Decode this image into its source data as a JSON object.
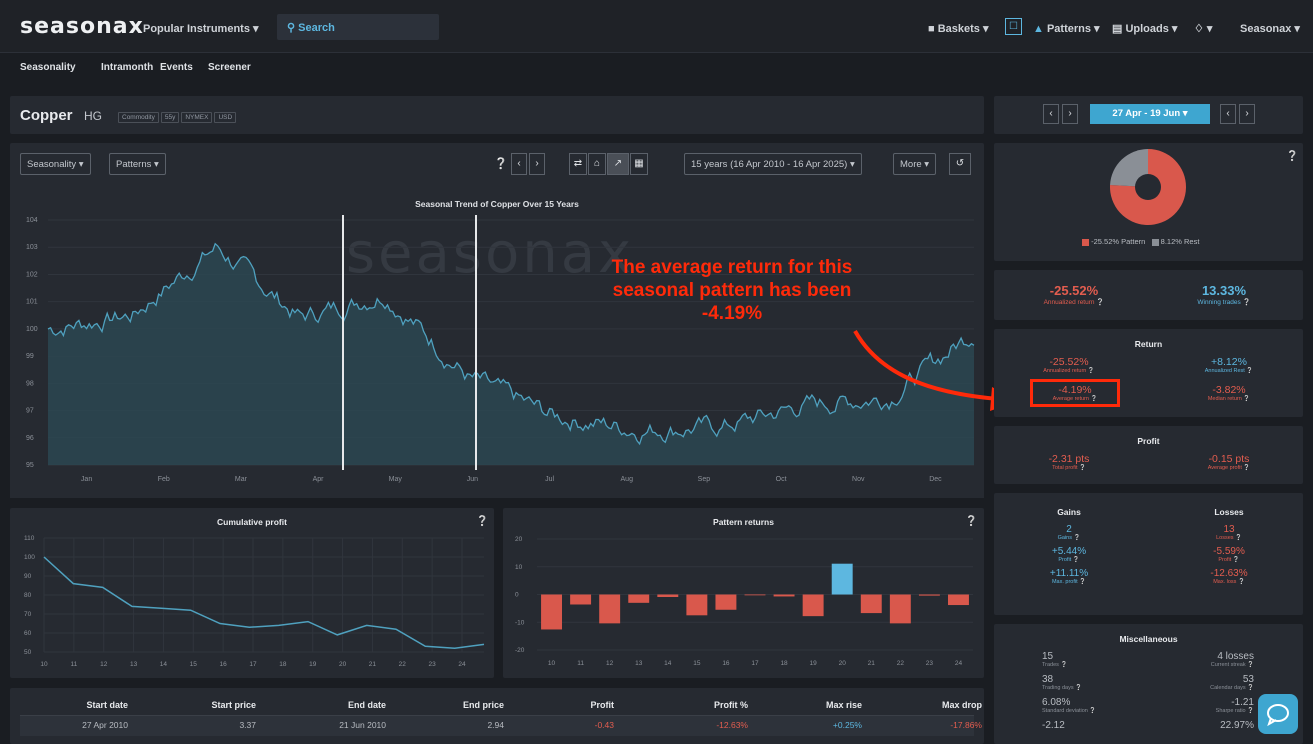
{
  "header": {
    "logo": "seasonax",
    "popular": "Popular Instruments ▾",
    "search": "Search",
    "baskets": "Baskets ▾",
    "patterns": "Patterns ▾",
    "uploads": "Uploads ▾",
    "bell": "▾",
    "account": "Seasonax ▾"
  },
  "subnav": [
    "Seasonality",
    "Intramonth",
    "Events",
    "Screener"
  ],
  "instrument": {
    "name": "Copper",
    "ticker": "HG",
    "tags": [
      "Commodity",
      "55y",
      "NYMEX",
      "USD"
    ]
  },
  "toolbar": {
    "seasonality": "Seasonality ▾",
    "patterns": "Patterns ▾",
    "range": "15 years (16 Apr 2010 - 16 Apr 2025) ▾",
    "more": "More ▾"
  },
  "date_range": "27 Apr - 19 Jun ▾",
  "main_chart": {
    "title": "Seasonal Trend of Copper Over 15 Years",
    "watermark": "seasonax",
    "y_ticks": [
      "104",
      "103",
      "102",
      "101",
      "100",
      "99",
      "98",
      "97",
      "96",
      "95"
    ],
    "x_ticks": [
      "Jan",
      "Feb",
      "Mar",
      "Apr",
      "May",
      "Jun",
      "Jul",
      "Aug",
      "Sep",
      "Oct",
      "Nov",
      "Dec"
    ]
  },
  "chart_data": [
    {
      "type": "area",
      "title": "Seasonal Trend of Copper Over 15 Years",
      "categories": [
        "Jan",
        "Feb",
        "Mar",
        "Apr",
        "May",
        "Jun",
        "Jul",
        "Aug",
        "Sep",
        "Oct",
        "Nov",
        "Dec"
      ],
      "ylim": [
        95,
        104
      ],
      "series": [
        {
          "values": [
            100.0,
            100.5,
            103.0,
            100.4,
            101.3,
            98.2,
            96.8,
            96.3,
            96.4,
            97.2,
            97.5,
            99.9
          ]
        }
      ],
      "highlight": [
        "27 Apr",
        "19 Jun"
      ]
    },
    {
      "type": "line",
      "title": "Cumulative profit",
      "categories": [
        "10",
        "11",
        "12",
        "13",
        "14",
        "15",
        "16",
        "17",
        "18",
        "19",
        "20",
        "21",
        "22",
        "23",
        "24"
      ],
      "ylim": [
        50,
        110
      ],
      "y_ticks": [
        "110",
        "100",
        "90",
        "80",
        "70",
        "60",
        "50"
      ],
      "series": [
        {
          "values": [
            100,
            86,
            84,
            74,
            73,
            72,
            65,
            63,
            64,
            66,
            59,
            64,
            62,
            53,
            52,
            54
          ]
        }
      ]
    },
    {
      "type": "bar",
      "title": "Pattern returns",
      "categories": [
        "10",
        "11",
        "12",
        "13",
        "14",
        "15",
        "16",
        "17",
        "18",
        "19",
        "20",
        "21",
        "22",
        "23",
        "24"
      ],
      "ylim": [
        -20,
        20
      ],
      "y_ticks": [
        "20",
        "10",
        "0",
        "-10",
        "-20"
      ],
      "values": [
        -12.6,
        -3.6,
        -10.4,
        -3.0,
        -0.9,
        -7.5,
        -5.5,
        -0.2,
        -0.7,
        -7.8,
        11.1,
        -6.7,
        -10.4,
        -0.4,
        -3.8
      ]
    },
    {
      "type": "pie",
      "labels": [
        "-25.52% Pattern",
        "8.12% Rest"
      ],
      "values": [
        25.52,
        8.12
      ],
      "colors": [
        "#d9584c",
        "#8a8f96"
      ]
    }
  ],
  "cum_chart": {
    "title": "Cumulative profit",
    "help": "?"
  },
  "ret_chart": {
    "title": "Pattern returns",
    "help": "?"
  },
  "annotation": "The average return for this seasonal pattern has been -4.19%",
  "stats": {
    "annualized": {
      "value": "-25.52%",
      "label": "Annualized return"
    },
    "winning": {
      "value": "13.33%",
      "label": "Winning trades"
    },
    "return_title": "Return",
    "return_items": [
      {
        "value": "-25.52%",
        "label": "Annualized return"
      },
      {
        "value": "+8.12%",
        "label": "Annualized Rest"
      },
      {
        "value": "-4.19%",
        "label": "Average return"
      },
      {
        "value": "-3.82%",
        "label": "Median return"
      }
    ],
    "profit_title": "Profit",
    "profit_items": [
      {
        "value": "-2.31 pts",
        "label": "Total profit"
      },
      {
        "value": "-0.15 pts",
        "label": "Average profit"
      }
    ],
    "gains_title": "Gains",
    "losses_title": "Losses",
    "gains": [
      {
        "value": "2",
        "label": "Gains"
      },
      {
        "value": "+5.44%",
        "label": "Profit"
      },
      {
        "value": "+11.11%",
        "label": "Max. profit"
      }
    ],
    "losses": [
      {
        "value": "13",
        "label": "Losses"
      },
      {
        "value": "-5.59%",
        "label": "Profit"
      },
      {
        "value": "-12.63%",
        "label": "Max. loss"
      }
    ],
    "misc_title": "Miscellaneous",
    "misc": [
      {
        "value": "15",
        "label": "Trades"
      },
      {
        "value": "4 losses",
        "label": "Current streak"
      },
      {
        "value": "38",
        "label": "Trading days"
      },
      {
        "value": "53",
        "label": "Calendar days"
      },
      {
        "value": "6.08%",
        "label": "Standard deviation"
      },
      {
        "value": "-1.21",
        "label": "Sharpe ratio"
      },
      {
        "value": "-2.12",
        "label": ""
      },
      {
        "value": "22.97%",
        "label": ""
      }
    ]
  },
  "table": {
    "headers": [
      "Start date",
      "Start price",
      "End date",
      "End price",
      "Profit",
      "Profit %",
      "Max rise",
      "Max drop"
    ],
    "rows": [
      [
        "27 Apr 2010",
        "3.37",
        "21 Jun 2010",
        "2.94",
        "-0.43",
        "-12.63%",
        "+0.25%",
        "-17.86%"
      ]
    ]
  },
  "colors": {
    "accent": "#3ea6d0",
    "negative": "#d9584c",
    "positive": "#5db7e0",
    "annotation": "#ff2a0a"
  }
}
